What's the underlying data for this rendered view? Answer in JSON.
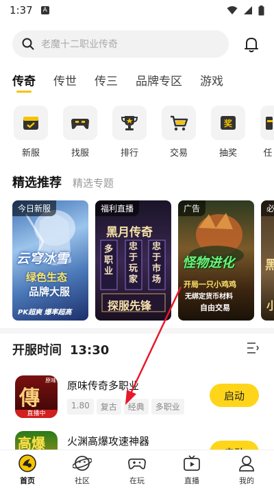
{
  "status_bar": {
    "time": "1:37",
    "notif_letter": "A"
  },
  "search": {
    "placeholder": "老魔十二职业传奇"
  },
  "tabs": [
    {
      "label": "传奇",
      "active": true
    },
    {
      "label": "传世",
      "active": false
    },
    {
      "label": "传三",
      "active": false
    },
    {
      "label": "品牌专区",
      "active": false
    },
    {
      "label": "游戏",
      "active": false
    }
  ],
  "shortcuts": [
    {
      "label": "新服",
      "icon": "calendar-icon"
    },
    {
      "label": "找服",
      "icon": "gamepad-icon"
    },
    {
      "label": "排行",
      "icon": "trophy-icon"
    },
    {
      "label": "交易",
      "icon": "cart-icon"
    },
    {
      "label": "抽奖",
      "icon": "prize-icon"
    },
    {
      "label": "任",
      "icon": "task-icon"
    }
  ],
  "featured": {
    "title": "精选推荐",
    "subtitle": "精选专题",
    "cards": [
      {
        "tag": "今日新服",
        "line1": "云穹冰雪",
        "line2": "绿色生态",
        "line3": "品牌大服",
        "line4": "PK超爽  爆率超高"
      },
      {
        "tag": "福利直播",
        "line1": "黑月传奇",
        "col1": "多职业",
        "col2": "忠于玩家",
        "col3": "忠于市场",
        "line4": "探服先锋"
      },
      {
        "tag": "广告",
        "line1": "怪物进化",
        "line2": "开局一只小鸡鸡",
        "line3": "无绑定货币材料",
        "line4": "自由交易"
      },
      {
        "tag": "必",
        "line1": "黑",
        "line2": "小"
      }
    ]
  },
  "servers": {
    "title": "开服时间",
    "time": "13:30",
    "items": [
      {
        "name": "原味传奇多职业",
        "tags": [
          "1.80",
          "复古",
          "经典",
          "多职业"
        ],
        "button": "启动",
        "icon_text": "傳",
        "icon_badge": "直播中",
        "icon_corner": "原味"
      },
      {
        "name": "火渊高爆攻速神器",
        "tags": [],
        "button": "启动",
        "icon_text": "高爆"
      }
    ]
  },
  "bottom_nav": [
    {
      "label": "首页",
      "icon": "home-icon",
      "active": true
    },
    {
      "label": "社区",
      "icon": "community-icon",
      "active": false
    },
    {
      "label": "在玩",
      "icon": "playing-icon",
      "active": false
    },
    {
      "label": "直播",
      "icon": "live-icon",
      "active": false
    },
    {
      "label": "我的",
      "icon": "profile-icon",
      "active": false
    }
  ],
  "colors": {
    "accent": "#ffd51a",
    "tab_underline": "#f5c400",
    "arrow": "#e8182a"
  }
}
